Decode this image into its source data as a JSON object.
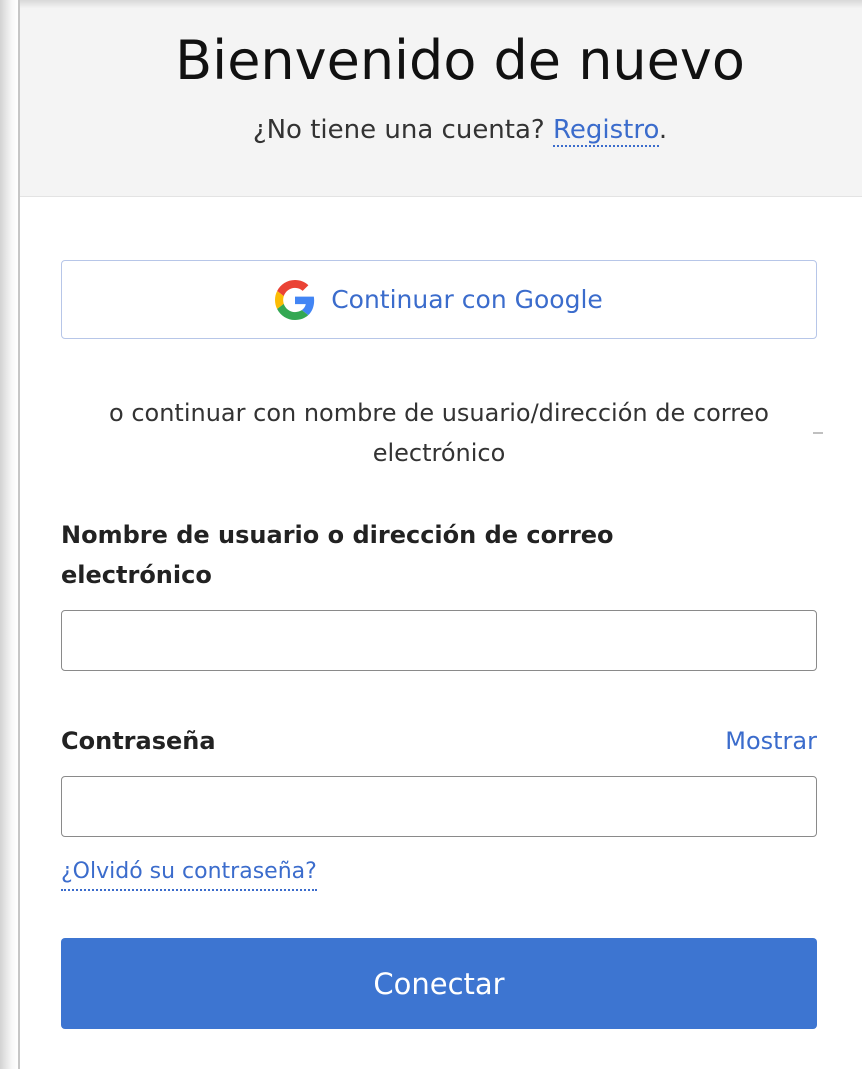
{
  "header": {
    "title": "Bienvenido de nuevo",
    "no_account_text": "¿No tiene una cuenta?",
    "register_link": "Registro",
    "period": "."
  },
  "google": {
    "icon": "google-g-icon",
    "label": "Continuar con Google"
  },
  "divider": {
    "text": "o continuar con nombre de usuario/dirección de correo electrónico"
  },
  "form": {
    "username_label": "Nombre de usuario o dirección de correo electrónico",
    "username_value": "",
    "password_label": "Contraseña",
    "password_value": "",
    "show_password": "Mostrar",
    "forgot_password": "¿Olvidó su contraseña?",
    "submit": "Conectar"
  },
  "colors": {
    "accent": "#3b6ccc",
    "primary_button": "#3d75d1",
    "header_bg": "#f4f4f4",
    "google_blue": "#4285F4",
    "google_red": "#EA4335",
    "google_yellow": "#FBBC05",
    "google_green": "#34A853"
  }
}
